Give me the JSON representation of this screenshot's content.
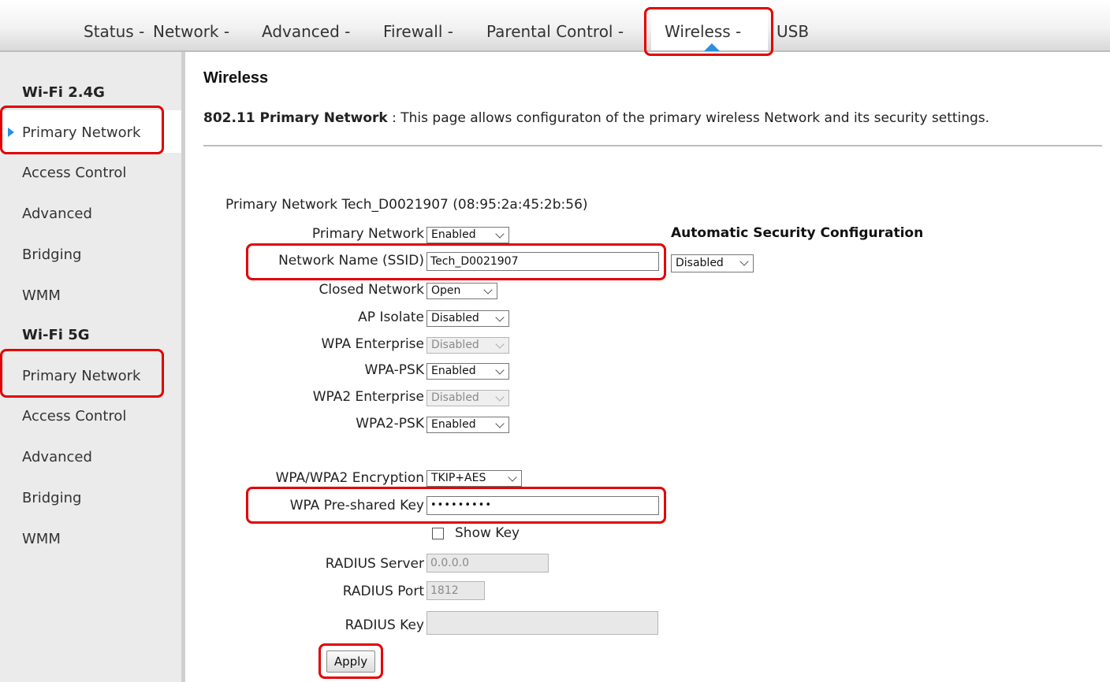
{
  "topnav": {
    "items": [
      "Status -",
      "Network -",
      "Advanced -",
      "Firewall -",
      "Parental Control -",
      "Wireless -",
      "USB"
    ],
    "active": "Wireless -"
  },
  "sidebar": {
    "group1": {
      "title": "Wi-Fi 2.4G",
      "items": [
        "Primary Network",
        "Access Control",
        "Advanced",
        "Bridging",
        "WMM"
      ]
    },
    "group2": {
      "title": "Wi-Fi 5G",
      "items": [
        "Primary Network",
        "Access Control",
        "Advanced",
        "Bridging",
        "WMM"
      ]
    },
    "selected": "Primary Network"
  },
  "main": {
    "title": "Wireless",
    "description_bold": "802.11 Primary Network",
    "description_sep": " : ",
    "description_text": "This page allows configuraton of the primary wireless Network and its security settings.",
    "network_line": "Primary Network Tech_D0021907 (08:95:2a:45:2b:56)",
    "fields": {
      "primary_network": {
        "label": "Primary Network",
        "value": "Enabled"
      },
      "ssid": {
        "label": "Network Name (SSID)",
        "value": "Tech_D0021907"
      },
      "closed_network": {
        "label": "Closed Network",
        "value": "Open"
      },
      "ap_isolate": {
        "label": "AP Isolate",
        "value": "Disabled"
      },
      "wpa_enterprise": {
        "label": "WPA Enterprise",
        "value": "Disabled"
      },
      "wpa_psk": {
        "label": "WPA-PSK",
        "value": "Enabled"
      },
      "wpa2_enterprise": {
        "label": "WPA2 Enterprise",
        "value": "Disabled"
      },
      "wpa2_psk": {
        "label": "WPA2-PSK",
        "value": "Enabled"
      },
      "encryption": {
        "label": "WPA/WPA2 Encryption",
        "value": "TKIP+AES"
      },
      "psk": {
        "label": "WPA Pre-shared Key",
        "value": "•••••••••"
      },
      "show_key": {
        "label": "Show Key",
        "checked": false
      },
      "radius_server": {
        "label": "RADIUS Server",
        "value": "0.0.0.0"
      },
      "radius_port": {
        "label": "RADIUS Port",
        "value": "1812"
      },
      "radius_key": {
        "label": "RADIUS Key",
        "value": ""
      }
    },
    "auto_security": {
      "title": "Automatic Security Configuration",
      "value": "Disabled"
    },
    "apply_label": "Apply"
  },
  "colors": {
    "highlight": "#e30000",
    "accent": "#2b8fdd"
  },
  "icons": {
    "nav_caret": "caret-up-icon",
    "sidebar_arrow": "caret-right-icon"
  }
}
